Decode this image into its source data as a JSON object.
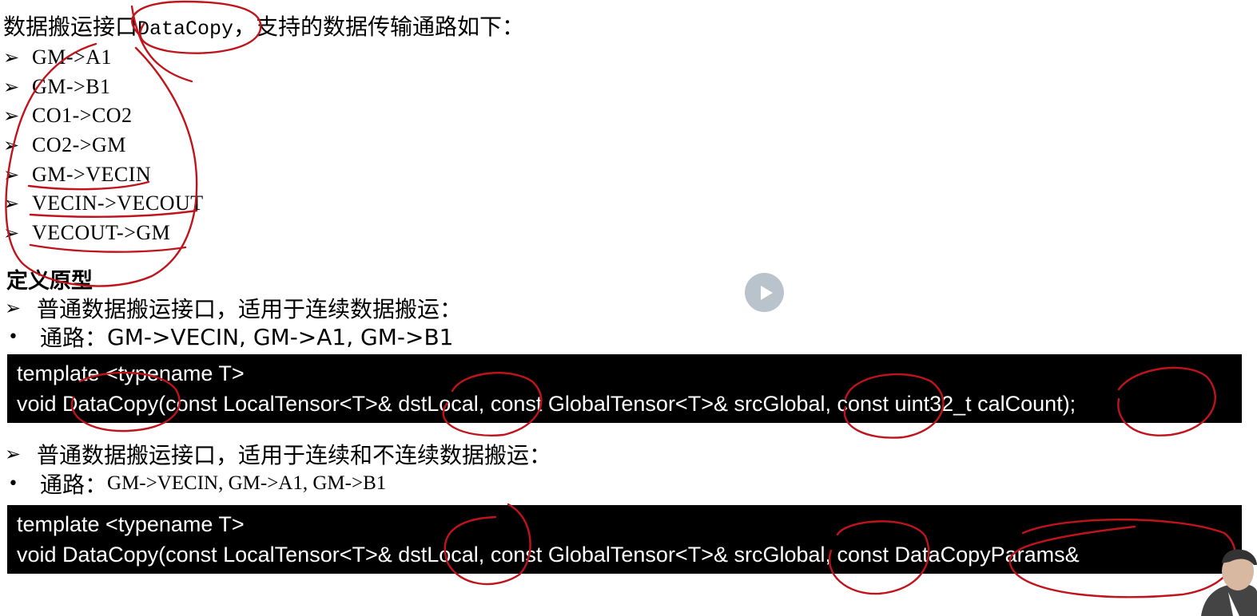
{
  "intro": {
    "prefix": "数据搬运接口",
    "api_name": "DataCopy",
    "suffix": "，支持的数据传输通路如下："
  },
  "paths": {
    "marker": "➢",
    "items": [
      "GM->A1",
      "GM->B1",
      "CO1->CO2",
      "CO2->GM",
      "GM->VECIN",
      "VECIN->VECOUT",
      "VECOUT->GM"
    ]
  },
  "section_title": "定义原型",
  "proto1": {
    "marker": "➢",
    "desc": "普通数据搬运接口，适用于连续数据搬运：",
    "bullet": "•",
    "path_label": "通路：",
    "path_value": "GM->VECIN, GM->A1, GM->B1",
    "code": [
      "template <typename T>",
      "void DataCopy(const LocalTensor<T>& dstLocal, const GlobalTensor<T>& srcGlobal, const uint32_t calCount);"
    ]
  },
  "proto2": {
    "marker": "➢",
    "desc": "普通数据搬运接口，适用于连续和不连续数据搬运：",
    "bullet": "•",
    "path_label": "通路：",
    "path_value": "GM->VECIN, GM->A1, GM->B1",
    "code": [
      "template <typename T>",
      "void DataCopy(const LocalTensor<T>& dstLocal, const GlobalTensor<T>& srcGlobal, const DataCopyParams&"
    ]
  },
  "colors": {
    "ink": "#c0141c",
    "code_bg": "#000000",
    "code_fg": "#ffffff",
    "play_button": "#b9c3cc"
  },
  "icons": {
    "play": "play-icon"
  }
}
